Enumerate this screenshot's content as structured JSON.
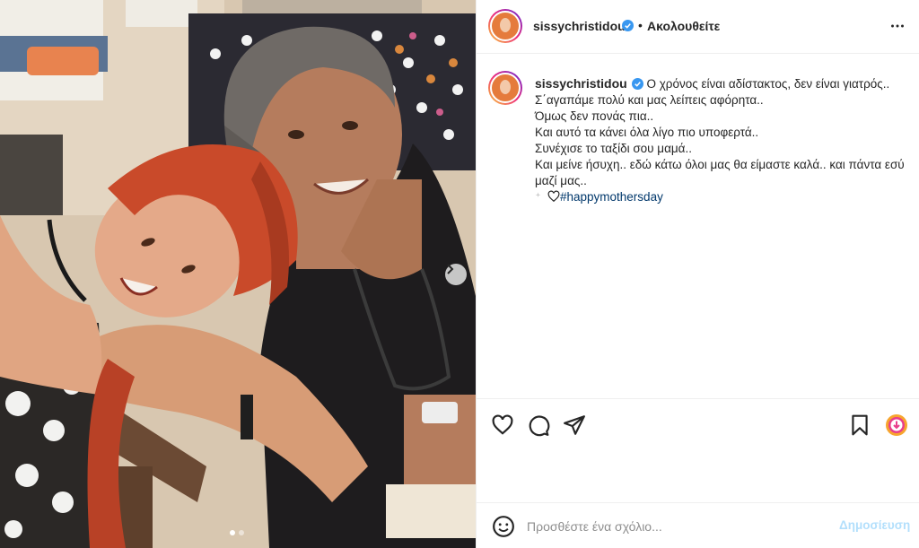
{
  "post": {
    "username": "sissychristidou",
    "verified": true,
    "separator": "•",
    "follow_label": "Ακολουθείτε",
    "caption_lines": [
      "Ο χρόνος είναι αδίστακτος, δεν είναι γιατρός..",
      "Σ΄αγαπάμε πολύ και μας λείπεις αφόρητα..",
      "Όμως δεν πονάς πια..",
      "Και αυτό τα κάνει όλα λίγο πιο υποφερτά..",
      "Συνέχισε το ταξίδι σου μαμά..",
      "Και μείνε ήσυχη.. εδώ κάτω όλοι μας θα είμαστε καλά.. και πάντα εσύ μαζί μας.."
    ],
    "hashtag": "#happymothersday",
    "carousel": {
      "total": 2,
      "current": 1
    }
  },
  "comment": {
    "placeholder": "Προσθέστε ένα σχόλιο...",
    "post_label": "Δημοσίευση"
  },
  "icons": {
    "verified": "verified-badge-icon",
    "more": "more-options-icon",
    "like": "heart-icon",
    "comment": "comment-icon",
    "share": "paper-plane-icon",
    "save": "bookmark-icon",
    "emoji": "emoji-icon"
  },
  "colors": {
    "verified": "#3897f0",
    "hashtag": "#00376b",
    "post_button_disabled": "#b2dffc",
    "border": "#efefef"
  }
}
